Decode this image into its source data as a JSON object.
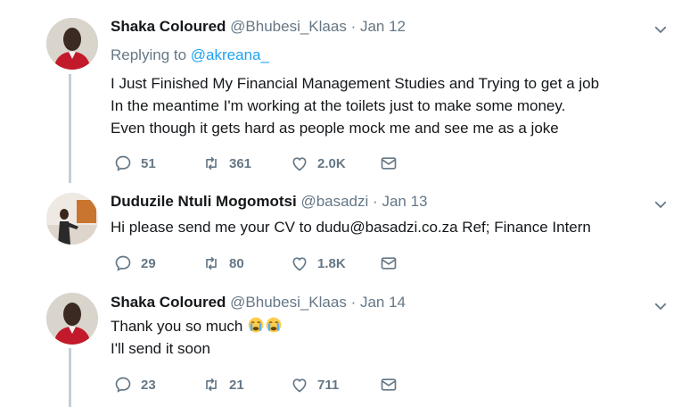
{
  "tweets": [
    {
      "name": "Shaka Coloured",
      "handle": "@Bhubesi_Klaas",
      "separator": "·",
      "date": "Jan 12",
      "replying_prefix": "Replying to",
      "replying_handle": "@akreana_",
      "lines": [
        "I Just Finished My Financial Management Studies and Trying to get a job",
        "In the meantime I'm working at the toilets just to make some money.",
        "Even though it gets hard as people mock me and see me as a joke"
      ],
      "replies": "51",
      "retweets": "361",
      "likes": "2.0K"
    },
    {
      "name": "Duduzile Ntuli Mogomotsi",
      "handle": "@basadzi",
      "separator": "·",
      "date": "Jan 13",
      "lines": [
        "Hi please send me your CV to dudu@basadzi.co.za Ref; Finance Intern"
      ],
      "replies": "29",
      "retweets": "80",
      "likes": "1.8K"
    },
    {
      "name": "Shaka Coloured",
      "handle": "@Bhubesi_Klaas",
      "separator": "·",
      "date": "Jan 14",
      "lines": [
        "Thank you so much",
        "I'll send it soon"
      ],
      "emoji": "crying-face-emoji",
      "replies": "23",
      "retweets": "21",
      "likes": "711"
    }
  ],
  "colors": {
    "secondary_text": "#657786",
    "link": "#1da1f2",
    "thread_line": "#c4cfd6"
  }
}
